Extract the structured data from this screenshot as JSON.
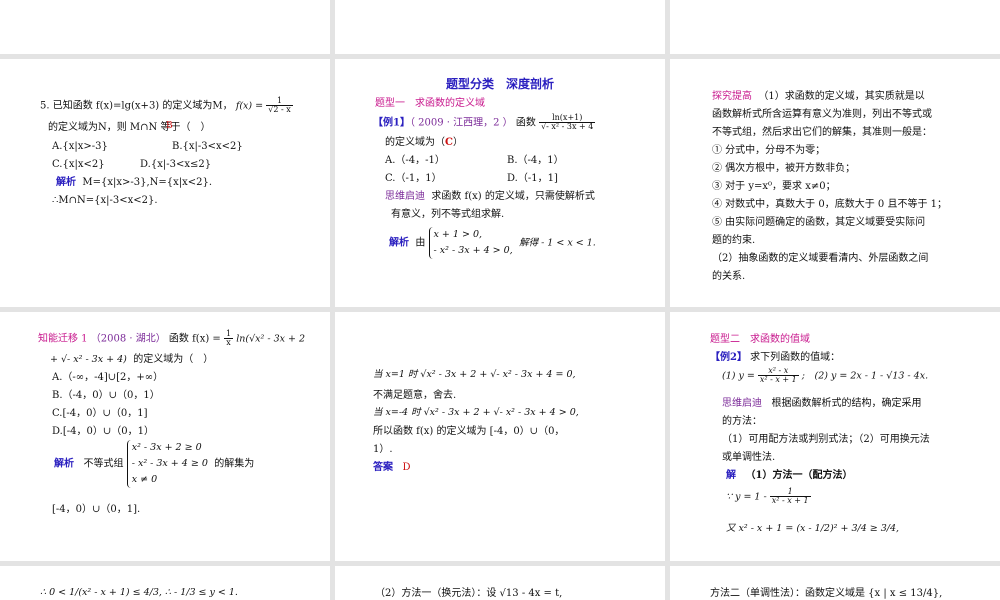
{
  "slide_tl": {
    "problem": "5. 已知函数 f(x)=lg(x+3) 的定义域为M，",
    "fx": "f(x) =",
    "frac_num": "1",
    "frac_den": "√2 - x",
    "problem2": "的定义域为N，则 M∩N 等于（　）",
    "optA": "A.{x|x>-3}",
    "optB": "B.{x|-3<x<2}",
    "optC": "C.{x|x<2}",
    "optD": "D.{x|-3<x≤2}",
    "jiexi_label": "解析",
    "jiexi_text": "M={x|x>-3},N={x|x<2}.",
    "conclusion": "∴M∩N={x|-3<x<2}.",
    "answer_mark": "B"
  },
  "slide_tc": {
    "title": "题型分类　深度剖析",
    "type1": "题型一　求函数的定义域",
    "ex1_label": "【例1】",
    "ex1_src": "（ 2009 · 江西理，2 ）",
    "ex1_text": "函数",
    "ex1_fn_num": "ln(x+1)",
    "ex1_fn_den": "√- x² - 3x + 4",
    "ex1_text2": "的定义域为（",
    "ex1_ans": "C",
    "ex1_close": "）",
    "optA": "A.（-4，-1）",
    "optB": "B.（-4，1）",
    "optC": "C.（-1，1）",
    "optD": "D.（-1，1]",
    "think_label": "思维启迪",
    "think_text": "求函数 f(x) 的定义域，只需使解析式",
    "think_text2": "有意义，列不等式组求解.",
    "jiexi_label": "解析",
    "you": "由",
    "sys1": "x + 1 > 0,",
    "sys2": "- x² - 3x + 4 > 0,",
    "result": "解得 - 1 < x < 1."
  },
  "slide_tr": {
    "label": "探究提高",
    "p1": "（1）求函数的定义域，其实质就是以",
    "p2": "函数解析式所含运算有意义为准则，列出不等式或",
    "p3": "不等式组，然后求出它们的解集，其准则一般是：",
    "r1": "① 分式中，分母不为零；",
    "r2": "② 偶次方根中，被开方数非负；",
    "r3": "③ 对于 y=x⁰，要求 x≠0；",
    "r4": "④ 对数式中，真数大于 0，底数大于 0 且不等于 1；",
    "r5": "⑤ 由实际问题确定的函数，其定义域要受实际问",
    "r5b": "题的约束.",
    "p4": "（2）抽象函数的定义域要看清内、外层函数之间",
    "p5": "的关系."
  },
  "slide_ml": {
    "label": "知能迁移 1",
    "src": "（2008 · 湖北）",
    "fn": "函数 f(x) = ",
    "fn_frac_num": "1",
    "fn_frac_den": "x",
    "fn_tail": "ln(√x² - 3x + 2",
    "fn_line2": "+ √- x² - 3x + 4)",
    "fn_line2b": "的定义域为（　）",
    "optA": "A.（-∞，-4]∪[2，+∞）",
    "optB": "B.（-4，0）∪（0，1）",
    "optC": "C.[-4，0）∪（0，1]",
    "optD": "D.[-4，0）∪（0，1）",
    "jiexi_label": "解析",
    "jiexi_text": "不等式组",
    "sys1": "x² - 3x + 2 ≥ 0",
    "sys2": "- x² - 3x + 4 ≥ 0",
    "sys3": "x ≠ 0",
    "jiexi_tail": "的解集为",
    "result": "[-4，0）∪（0，1]."
  },
  "slide_mc": {
    "l1": "当 x=1 时 √x² - 3x + 2 + √- x² - 3x + 4 = 0,",
    "l2": "不满足题意，舍去.",
    "l3": "当 x=-4 时 √x² - 3x + 2 + √- x² - 3x + 4 > 0,",
    "l4": "所以函数 f(x) 的定义域为 [-4，0）∪（0，",
    "l5": "1）.",
    "ans_label": "答案",
    "ans": "D"
  },
  "slide_mr": {
    "type2": "题型二　求函数的值域",
    "ex2_label": "【例2】",
    "ex2_text": "求下列函数的值域：",
    "f1": "(1) y = ",
    "f1_num": "x² - x",
    "f1_den": "x² - x + 1",
    "f2": ";　(2) y = 2x - 1 - √13 - 4x.",
    "think_label": "思维启迪",
    "think_text": "根据函数解析式的结构，确定采用",
    "think_text2": "的方法：",
    "m1": "（1）可用配方法或判别式法；（2）可用换元法",
    "m1b": "或单调性法.",
    "jie": "解",
    "method1": "（1）方法一（配方法）",
    "eq1": "∵ y = 1 - ",
    "eq1_num": "1",
    "eq1_den": "x² - x + 1",
    "eq2": "又 x² - x + 1 = (x - 1/2)² + 3/4 ≥ 3/4,"
  },
  "slide_bl": {
    "text": "∴ 0 < 1/(x² - x + 1) ≤ 4/3, ∴ - 1/3 ≤ y < 1."
  },
  "slide_bc": {
    "text": "（2）方法一（换元法）：设 √13 - 4x = t,"
  },
  "slide_br": {
    "text": "方法二（单调性法）：函数定义域是 {x | x ≤ 13/4},"
  }
}
